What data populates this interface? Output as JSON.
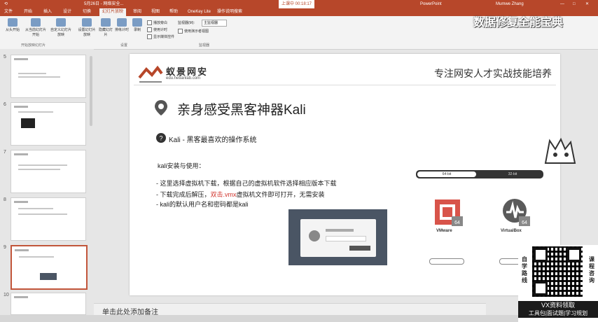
{
  "titlebar": {
    "items": [
      "开始",
      "插入",
      "设计",
      "切换",
      "动画",
      "幻灯片放映",
      "审阅",
      "视图",
      "帮助",
      "OneKey Lite",
      "操作说明搜索"
    ],
    "file_title": "5月26日 - 网络安全... ",
    "recording": "上课中 00:18:17",
    "app_name": "PowerPoint",
    "user": "Mumwe Zhang"
  },
  "ribbon_tabs": [
    "文件",
    "开始",
    "插入",
    "设计",
    "切换",
    "动画",
    "幻灯片放映",
    "审阅",
    "视图",
    "帮助",
    "OneKey Lite"
  ],
  "ribbon_active_tab": "幻灯片放映",
  "ribbon": {
    "buttons": [
      "从头开始",
      "从当前幻灯片开始",
      "自定义幻灯片放映",
      "设置幻灯片放映",
      "隐藏幻灯片",
      "排练计时",
      "录制"
    ],
    "checkboxes": [
      "播放旁白",
      "使用计时",
      "显示媒体控件"
    ],
    "monitor_label": "监视器(M):",
    "monitor_value": "主监视器",
    "presenter_view": "使用演示者视图",
    "group_labels": [
      "开始放映幻灯片",
      "设置",
      "监视器"
    ]
  },
  "thumbnails": {
    "numbers": [
      "5",
      "6",
      "7",
      "8",
      "9",
      "10"
    ]
  },
  "slide": {
    "logo": "蚁景网安",
    "logo_sub": "edu.hetianlab.com",
    "tagline": "专注网安人才实战技能培养",
    "title": "亲身感受黑客神器Kali",
    "subtitle": "Kali - 黑客最喜欢的操作系统",
    "intro": "kali安装与使用：",
    "bullet1": "-    这里选择虚拟机下载，根据自己的虚拟机软件选择相应版本下载",
    "bullet2_a": "-    下载完成后解压，",
    "bullet2_red": "双击.vmx",
    "bullet2_b": "虚拟机文件即可打开，无需安装",
    "bullet3": "-    kali的默认用户名和密码都是kali",
    "tab1": "64-bit",
    "tab2": "32-bit",
    "vendor1": "VMware",
    "vendor2": "VirtualBox"
  },
  "notes": {
    "placeholder": "单击此处添加备注"
  },
  "overlay": {
    "title": "数据修复全能宝典"
  },
  "promo": {
    "left_vertical": [
      "自",
      "学",
      "路",
      "线"
    ],
    "right_vertical": [
      "课",
      "程",
      "咨",
      "询"
    ],
    "caption1": "VX资料领取",
    "caption2": "工具包|面试题|学习规划"
  },
  "colors": {
    "accent": "#b7472a",
    "red_text": "#d0322a"
  }
}
